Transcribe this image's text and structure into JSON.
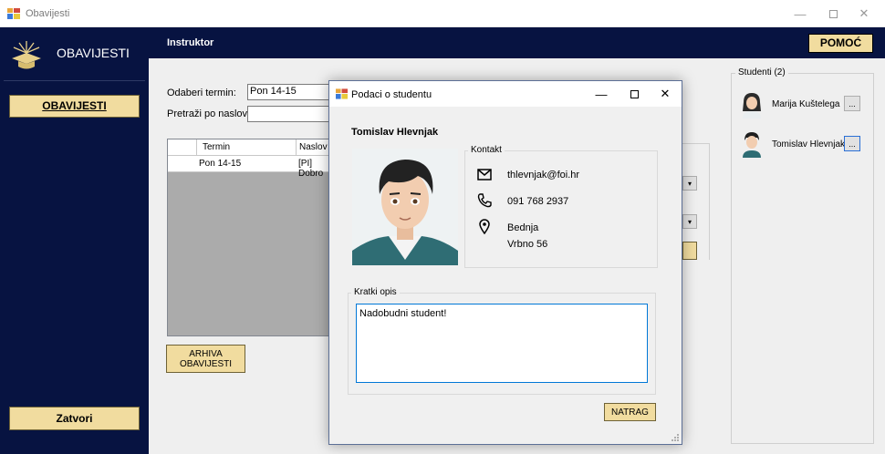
{
  "window": {
    "title": "Obavijesti"
  },
  "sidebar": {
    "brand": "OBAVIJESTI",
    "nav_button": "OBAVIJESTI",
    "close_button": "Zatvori"
  },
  "topbar": {
    "title": "Instruktor",
    "help_button": "POMOĆ"
  },
  "filters": {
    "term_label": "Odaberi termin:",
    "term_value": "Pon 14-15",
    "search_label": "Pretraži po naslovu:",
    "search_value": ""
  },
  "grid": {
    "columns": [
      "Termin",
      "Naslov"
    ],
    "rows": [
      [
        "Pon 14-15",
        "[PI] Dobro"
      ]
    ]
  },
  "archive_button": "ARHIVA\nOBAVIJESTI",
  "students": {
    "title": "Studenti (2)",
    "list": [
      {
        "name": "Marija Kuštelega",
        "button": "..."
      },
      {
        "name": "Tomislav Hlevnjak",
        "button": "..."
      }
    ]
  },
  "dialog": {
    "title": "Podaci o studentu",
    "student_name": "Tomislav Hlevnjak",
    "contact_title": "Kontakt",
    "email": "thlevnjak@foi.hr",
    "phone": "091 768 2937",
    "address_line1": "Bednja",
    "address_line2": "Vrbno 56",
    "description_title": "Kratki opis",
    "description": "Nadobudni student!",
    "back_button": "NATRAG"
  },
  "icons": [
    "app-icon",
    "graduation-cap-icon",
    "minimize-icon",
    "maximize-icon",
    "close-icon",
    "mail-icon",
    "phone-icon",
    "location-pin-icon",
    "dropdown-arrow-icon"
  ],
  "colors": {
    "navy": "#071341",
    "gold": "#f1dc9f",
    "content_bg": "#efefef",
    "dialog_bg": "#f0f0f0"
  }
}
